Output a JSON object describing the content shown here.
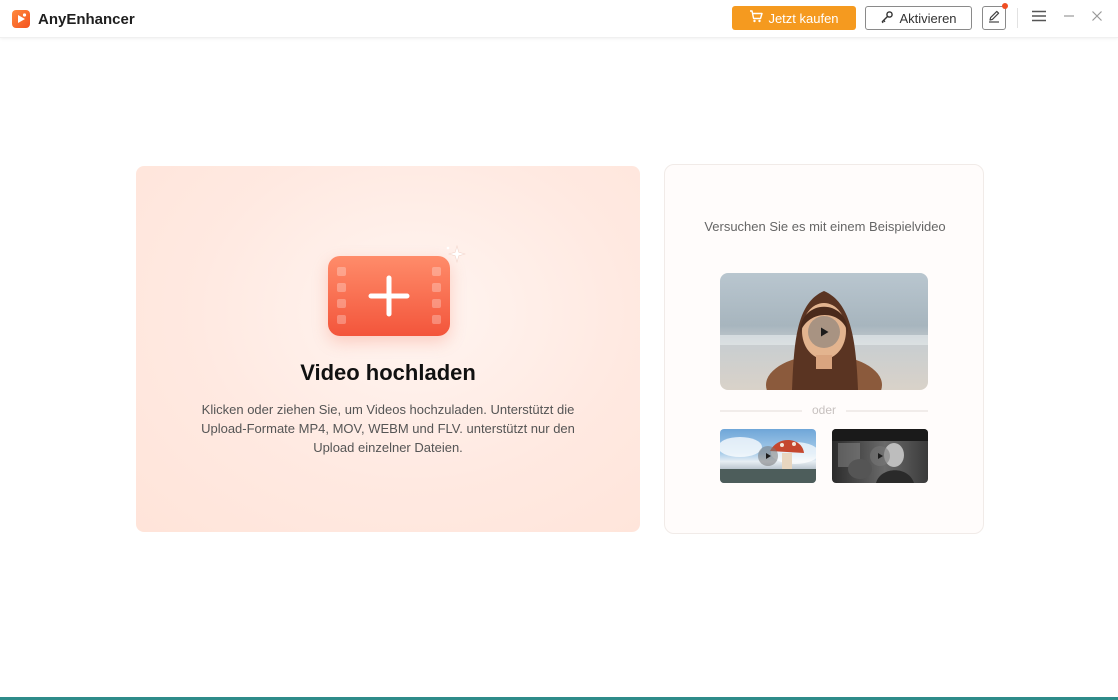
{
  "app": {
    "title": "AnyEnhancer",
    "brand_color": "#f4511e"
  },
  "toolbar": {
    "buy_label": "Jetzt kaufen",
    "activate_label": "Aktivieren",
    "buy_color": "#f59a1f",
    "icons": [
      "cart-icon",
      "key-icon",
      "feedback-pen-icon",
      "menu-icon",
      "minimize-icon",
      "close-icon"
    ]
  },
  "upload": {
    "title": "Video hochladen",
    "description": "Klicken oder ziehen Sie, um Videos hochzuladen. Unterstützt die Upload-Formate MP4, MOV, WEBM und FLV. unterstützt nur den Upload einzelner Dateien.",
    "icon": "video-add-icon"
  },
  "samples": {
    "heading": "Versuchen Sie es mit einem Beispielvideo",
    "or_label": "oder",
    "videos": [
      {
        "kind": "main",
        "icon": "play-icon"
      },
      {
        "kind": "thumb",
        "icon": "play-icon"
      },
      {
        "kind": "thumb",
        "icon": "play-icon"
      }
    ]
  }
}
